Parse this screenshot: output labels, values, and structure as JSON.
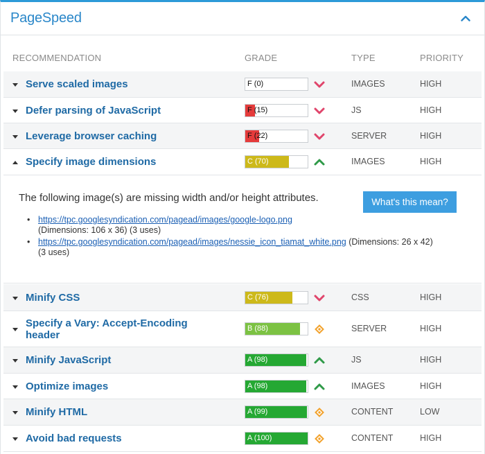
{
  "panel": {
    "title": "PageSpeed"
  },
  "columns": {
    "recommendation": "RECOMMENDATION",
    "grade": "GRADE",
    "type": "TYPE",
    "priority": "PRIORITY"
  },
  "colors": {
    "red": "#e53b3b",
    "yellow": "#cdb91a",
    "lightgreen": "#7cc243",
    "green": "#25a833",
    "trend_down": "#e0456b",
    "trend_up": "#2f9a48",
    "trend_neutral": "#f2a22c"
  },
  "rows_top": [
    {
      "title": "Serve scaled images",
      "grade": "F (0)",
      "score": 0,
      "grade_color": "red",
      "trend": "down",
      "type": "IMAGES",
      "priority": "HIGH",
      "expanded": false
    },
    {
      "title": "Defer parsing of JavaScript",
      "grade": "F (15)",
      "score": 15,
      "grade_color": "red",
      "trend": "down",
      "type": "JS",
      "priority": "HIGH",
      "expanded": false
    },
    {
      "title": "Leverage browser caching",
      "grade": "F (22)",
      "score": 22,
      "grade_color": "red",
      "trend": "down",
      "type": "SERVER",
      "priority": "HIGH",
      "expanded": false
    },
    {
      "title": "Specify image dimensions",
      "grade": "C (70)",
      "score": 70,
      "grade_color": "yellow",
      "trend": "up",
      "type": "IMAGES",
      "priority": "HIGH",
      "expanded": true
    }
  ],
  "details": {
    "description": "The following image(s) are missing width and/or height attributes.",
    "help_button": "What's this mean?",
    "images": [
      {
        "url": "https://tpc.googlesyndication.com/pagead/images/google-logo.png",
        "info": "(Dimensions: 106 x 36) (3 uses)"
      },
      {
        "url": "https://tpc.googlesyndication.com/pagead/images/nessie_icon_tiamat_white.png",
        "info_inline": "(Dimensions: 26 x 42)",
        "info": "(3 uses)"
      }
    ]
  },
  "rows_bottom": [
    {
      "title": "Minify CSS",
      "grade": "C (76)",
      "score": 76,
      "grade_color": "yellow",
      "trend": "down",
      "type": "CSS",
      "priority": "HIGH"
    },
    {
      "title": "Specify a Vary: Accept-Encoding header",
      "grade": "B (88)",
      "score": 88,
      "grade_color": "lightgreen",
      "trend": "neutral",
      "type": "SERVER",
      "priority": "HIGH"
    },
    {
      "title": "Minify JavaScript",
      "grade": "A (98)",
      "score": 98,
      "grade_color": "green",
      "trend": "up",
      "type": "JS",
      "priority": "HIGH"
    },
    {
      "title": "Optimize images",
      "grade": "A (98)",
      "score": 98,
      "grade_color": "green",
      "trend": "up",
      "type": "IMAGES",
      "priority": "HIGH"
    },
    {
      "title": "Minify HTML",
      "grade": "A (99)",
      "score": 99,
      "grade_color": "green",
      "trend": "neutral",
      "type": "CONTENT",
      "priority": "LOW"
    },
    {
      "title": "Avoid bad requests",
      "grade": "A (100)",
      "score": 100,
      "grade_color": "green",
      "trend": "neutral",
      "type": "CONTENT",
      "priority": "HIGH"
    }
  ]
}
